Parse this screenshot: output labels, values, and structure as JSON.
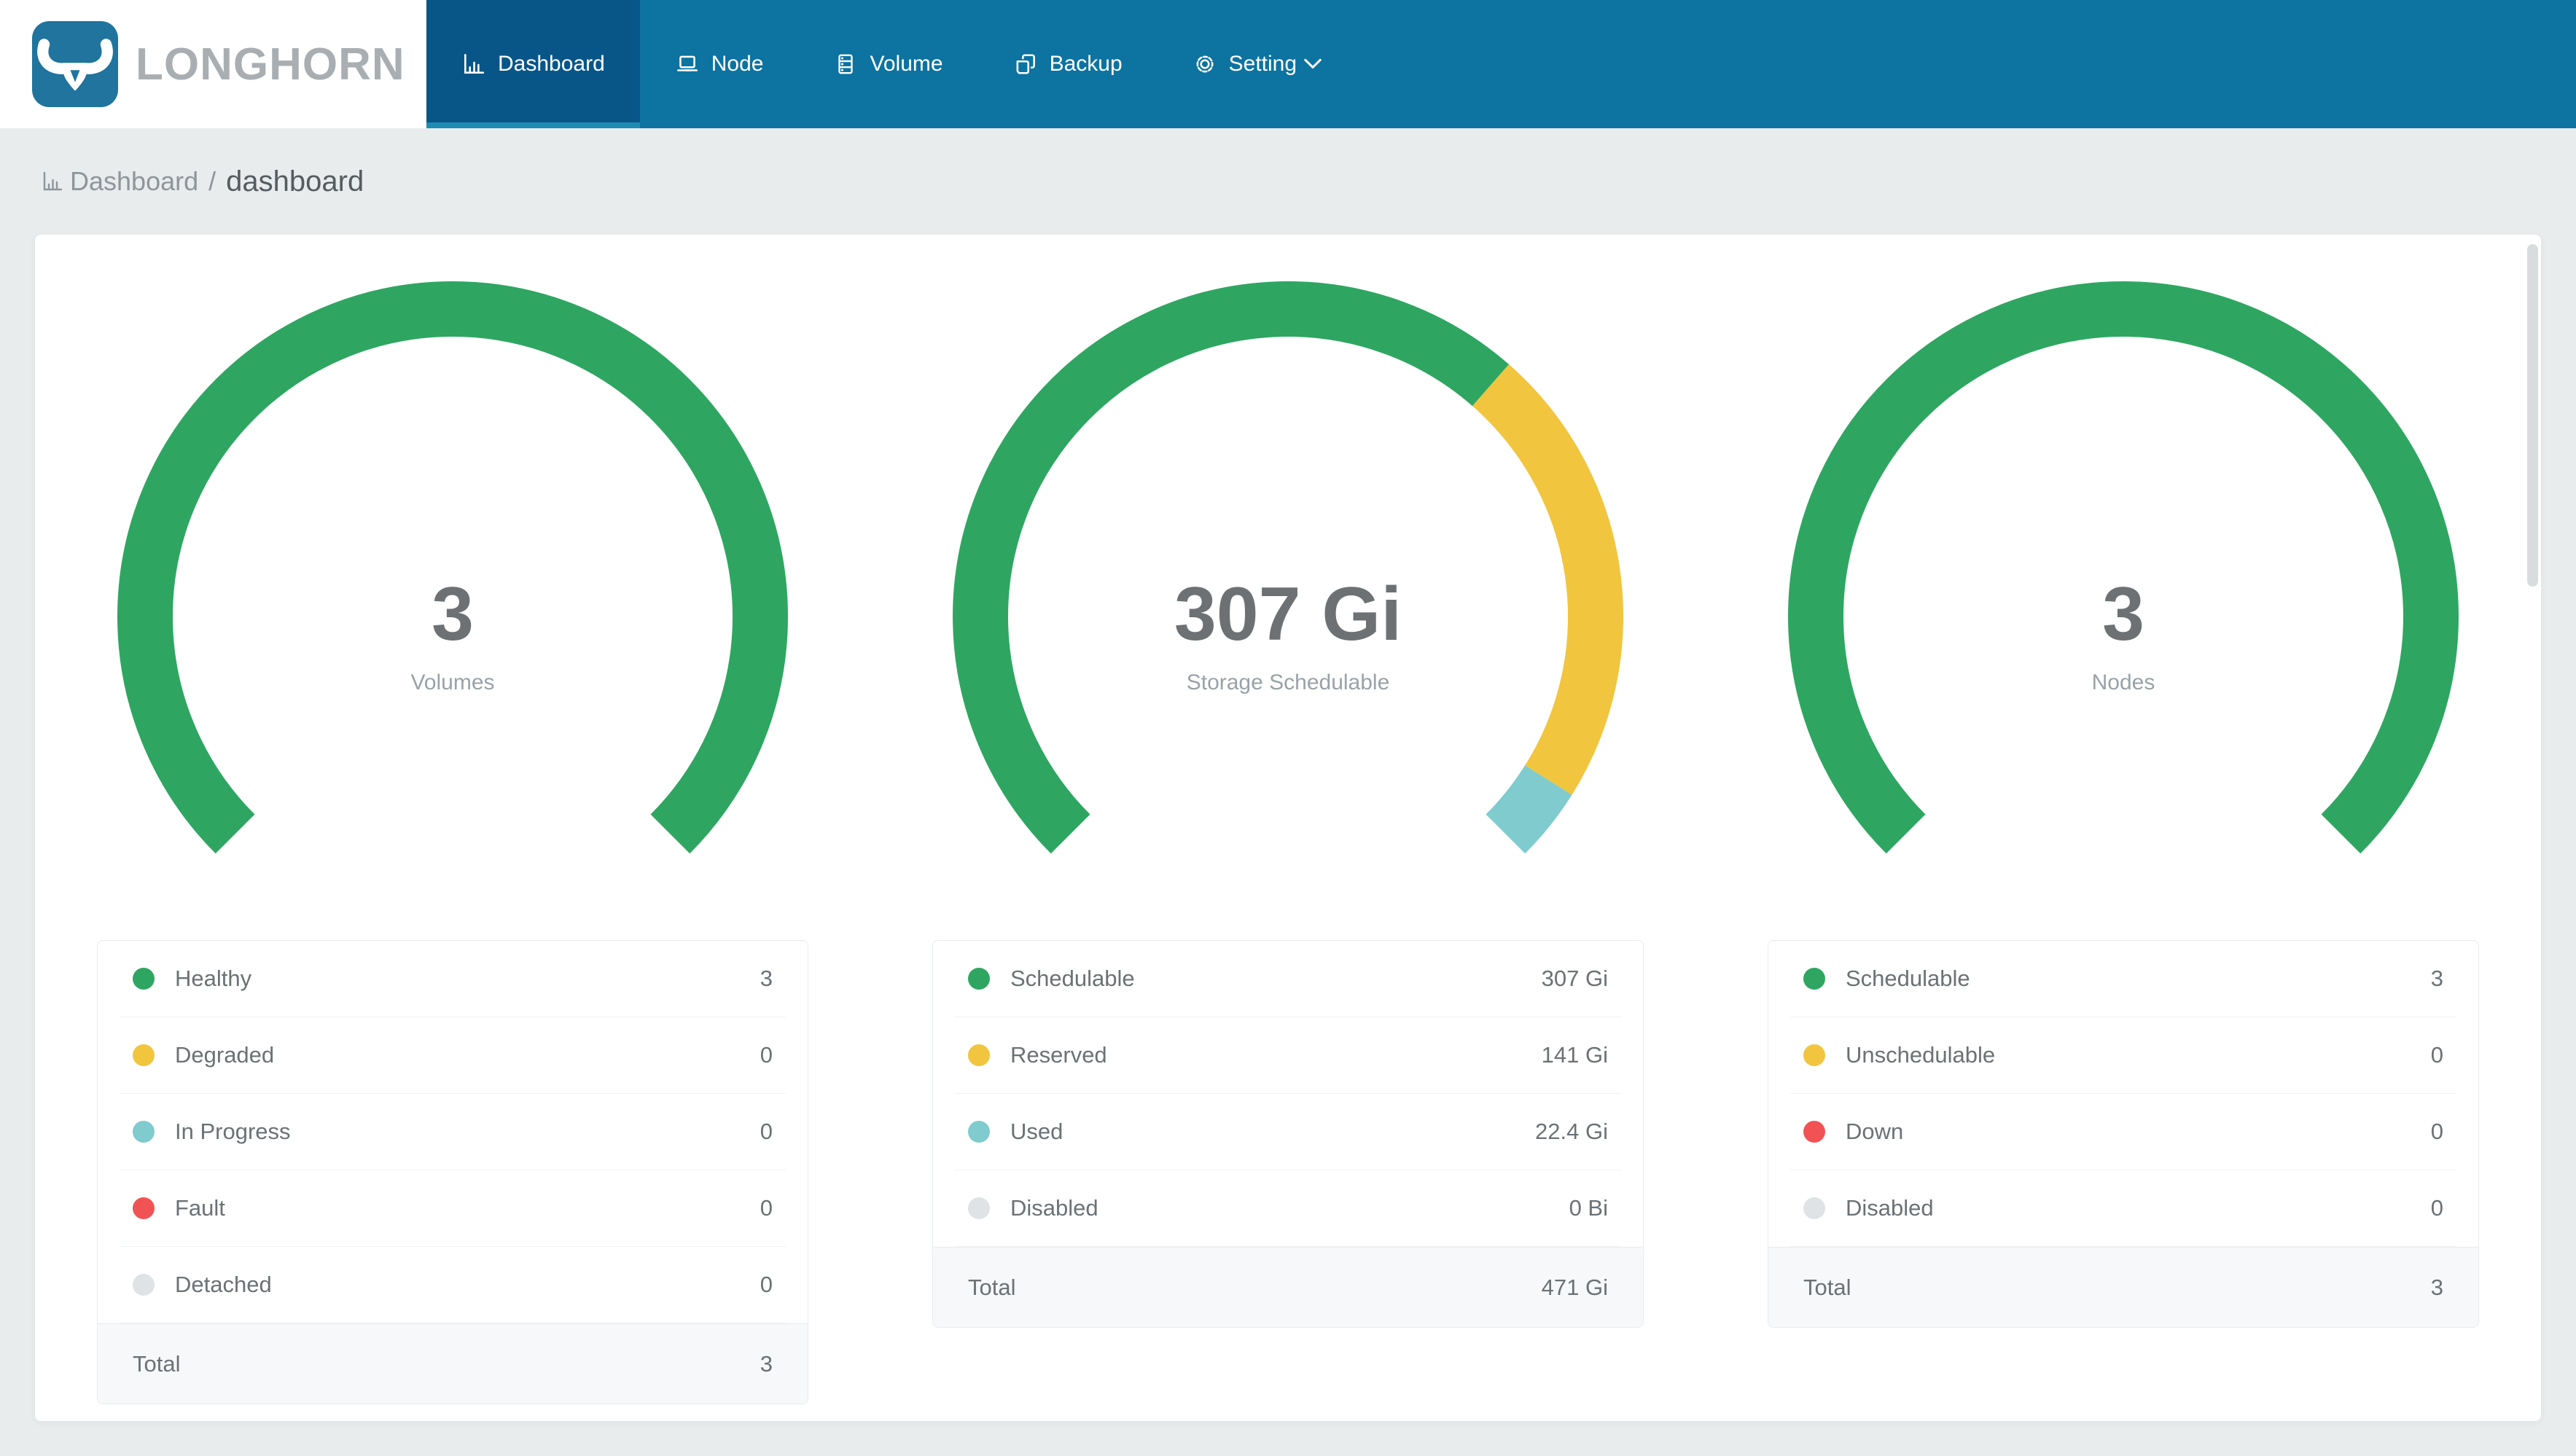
{
  "nav": {
    "logo_text": "LONGHORN",
    "items": [
      {
        "label": "Dashboard",
        "icon": "bar-chart-icon",
        "active": true,
        "has_dropdown": false
      },
      {
        "label": "Node",
        "icon": "laptop-icon",
        "active": false,
        "has_dropdown": false
      },
      {
        "label": "Volume",
        "icon": "server-stack-icon",
        "active": false,
        "has_dropdown": false
      },
      {
        "label": "Backup",
        "icon": "copy-icon",
        "active": false,
        "has_dropdown": false
      },
      {
        "label": "Setting",
        "icon": "gear-icon",
        "active": false,
        "has_dropdown": true
      }
    ]
  },
  "breadcrumb": {
    "icon": "bar-chart-icon",
    "section": "Dashboard",
    "separator": "/",
    "page": "dashboard"
  },
  "colors": {
    "green": "#2ea661",
    "yellow": "#f1c53e",
    "teal": "#7fcbce",
    "red": "#f15355",
    "gray": "#dfe3e5",
    "brand_blue": "#20749d",
    "nav_blue": "#0d73a1",
    "nav_active_blue": "#085687",
    "nav_underline_blue": "#1d8cb4"
  },
  "chart_data": [
    {
      "type": "donut-gauge",
      "arc_span_degrees": 270,
      "gap_position": "bottom",
      "center_value": "3",
      "center_label": "Volumes",
      "rows": [
        {
          "label": "Healthy",
          "value": 3,
          "display": "3",
          "color": "green"
        },
        {
          "label": "Degraded",
          "value": 0,
          "display": "0",
          "color": "yellow"
        },
        {
          "label": "In Progress",
          "value": 0,
          "display": "0",
          "color": "teal"
        },
        {
          "label": "Fault",
          "value": 0,
          "display": "0",
          "color": "red"
        },
        {
          "label": "Detached",
          "value": 0,
          "display": "0",
          "color": "gray"
        }
      ],
      "total": {
        "label": "Total",
        "display": "3"
      }
    },
    {
      "type": "donut-gauge",
      "arc_span_degrees": 270,
      "gap_position": "bottom",
      "center_value": "307 Gi",
      "center_label": "Storage Schedulable",
      "rows": [
        {
          "label": "Schedulable",
          "value": 307,
          "display": "307 Gi",
          "color": "green"
        },
        {
          "label": "Reserved",
          "value": 141,
          "display": "141 Gi",
          "color": "yellow"
        },
        {
          "label": "Used",
          "value": 22.4,
          "display": "22.4 Gi",
          "color": "teal"
        },
        {
          "label": "Disabled",
          "value": 0,
          "display": "0 Bi",
          "color": "gray"
        }
      ],
      "total": {
        "label": "Total",
        "display": "471 Gi"
      }
    },
    {
      "type": "donut-gauge",
      "arc_span_degrees": 270,
      "gap_position": "bottom",
      "center_value": "3",
      "center_label": "Nodes",
      "rows": [
        {
          "label": "Schedulable",
          "value": 3,
          "display": "3",
          "color": "green"
        },
        {
          "label": "Unschedulable",
          "value": 0,
          "display": "0",
          "color": "yellow"
        },
        {
          "label": "Down",
          "value": 0,
          "display": "0",
          "color": "red"
        },
        {
          "label": "Disabled",
          "value": 0,
          "display": "0",
          "color": "gray"
        }
      ],
      "total": {
        "label": "Total",
        "display": "3"
      }
    }
  ]
}
